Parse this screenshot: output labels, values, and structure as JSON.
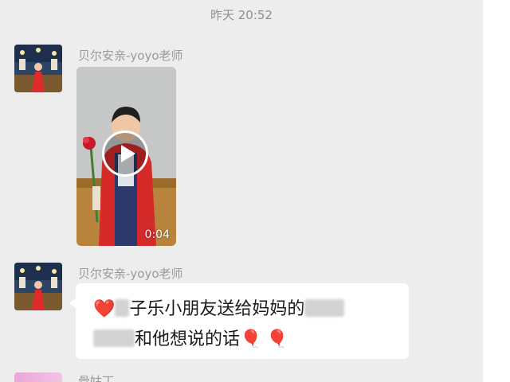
{
  "chat": {
    "timestamp": "昨天 20:52",
    "messages": [
      {
        "sender": "贝尔安亲-yoyo老师",
        "type": "video",
        "duration": "0:04"
      },
      {
        "sender": "贝尔安亲-yoyo老师",
        "type": "text",
        "line1_a": "子乐小朋友送给妈妈的",
        "line2_b": "和他想说的话"
      }
    ],
    "next_sender_partial": "骨姑丁"
  },
  "icons": {
    "heart": "red-heart-icon",
    "balloon": "red-balloon-icon",
    "play": "play-icon"
  },
  "colors": {
    "chat_background": "#ededed",
    "bubble": "#ffffff",
    "sender_name": "#9a9a9a",
    "timestamp": "#8f8f8f",
    "jacket_red": "#d42a2a"
  }
}
